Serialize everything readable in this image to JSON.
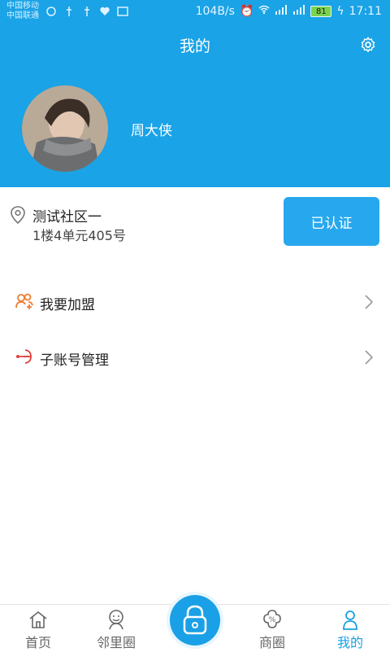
{
  "status_bar": {
    "carrier_1": "中国移动",
    "carrier_2": "中国联通",
    "speed": "104B/s",
    "battery": "81",
    "time": "17:11"
  },
  "header": {
    "title": "我的",
    "username": "周大侠"
  },
  "community": {
    "name": "测试社区一",
    "address": "1楼4单元405号",
    "verify_label": "已认证"
  },
  "menu": {
    "items": [
      {
        "label": "我要加盟",
        "icon": "join-people-icon",
        "color": "#f07a2e"
      },
      {
        "label": "子账号管理",
        "icon": "sub-account-icon",
        "color": "#e0403b"
      }
    ]
  },
  "bottom_nav": {
    "items": [
      {
        "label": "首页",
        "icon": "home-icon"
      },
      {
        "label": "邻里圈",
        "icon": "neighbor-icon"
      },
      {
        "label": "商圈",
        "icon": "shop-icon"
      },
      {
        "label": "我的",
        "icon": "profile-icon",
        "active": true
      }
    ]
  },
  "colors": {
    "primary": "#1aa3e6",
    "button": "#27a8ee",
    "active_nav": "#19a0e3"
  }
}
